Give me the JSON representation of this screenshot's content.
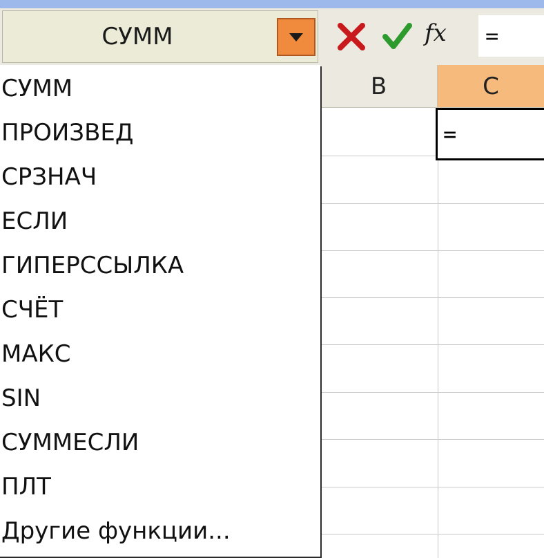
{
  "name_box": {
    "value": "СУММ"
  },
  "formula_bar": {
    "cancel_icon": "close-icon",
    "enter_icon": "check-icon",
    "fx_label": "fx",
    "input_value": "="
  },
  "columns": [
    {
      "label": "B"
    },
    {
      "label": "C"
    }
  ],
  "active_cell": {
    "value": "="
  },
  "function_list": {
    "items": [
      "СУММ",
      "ПРОИЗВЕД",
      "СРЗНАЧ",
      "ЕСЛИ",
      "ГИПЕРССЫЛКА",
      "СЧЁТ",
      "МАКС",
      "SIN",
      "СУММЕСЛИ",
      "ПЛТ",
      "Другие функции..."
    ]
  },
  "colors": {
    "accent_orange": "#f08a3c",
    "header_selected": "#f6bb7c",
    "cancel_red": "#c8191d",
    "enter_green": "#2d9a2d"
  }
}
